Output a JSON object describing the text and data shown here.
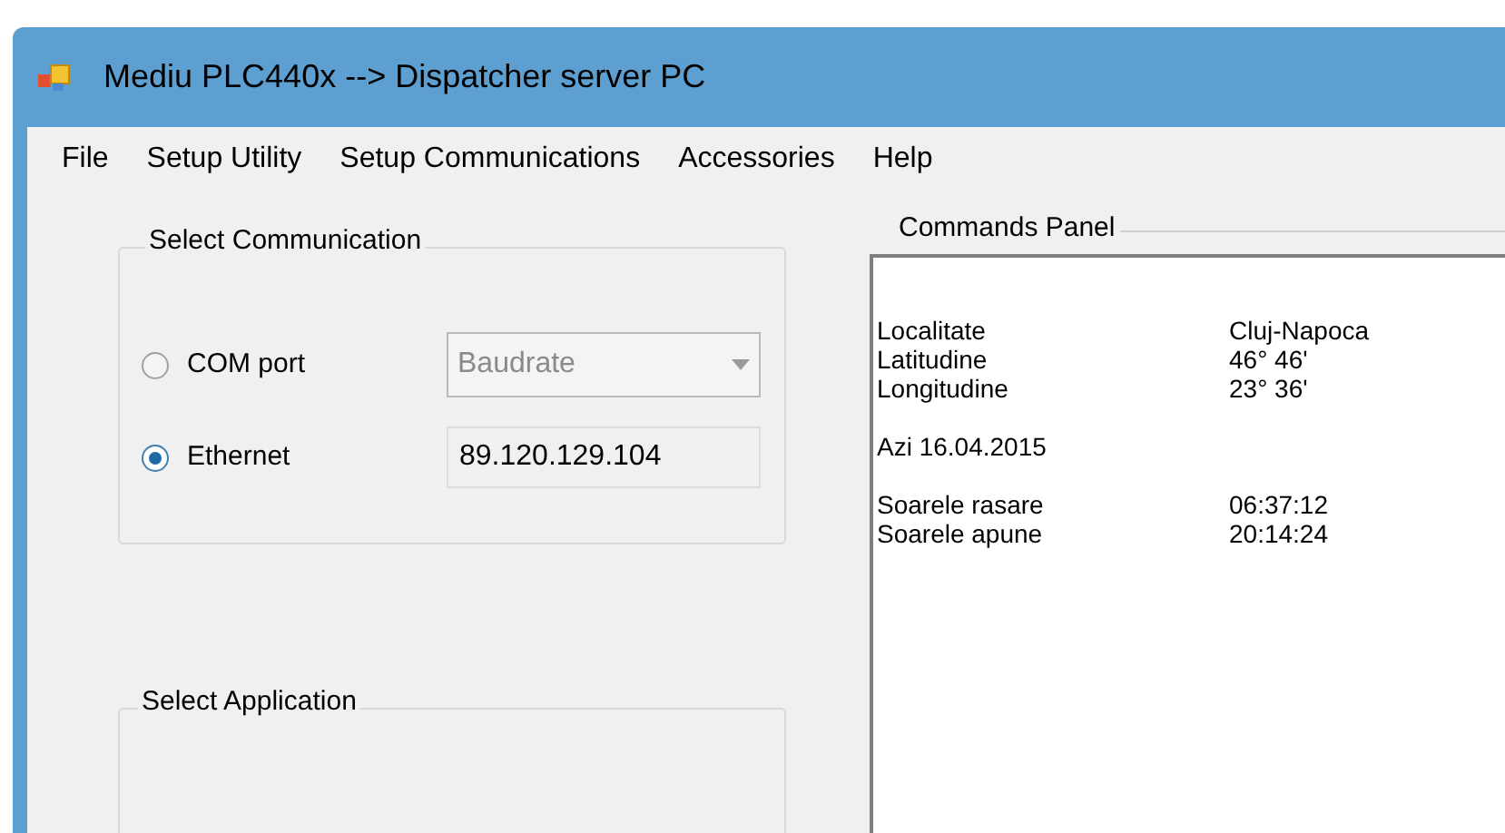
{
  "window": {
    "title": "Mediu PLC440x --> Dispatcher server PC"
  },
  "menu": [
    "File",
    "Setup Utility",
    "Setup Communications",
    "Accessories",
    "Help"
  ],
  "select_communication": {
    "title": "Select Communication",
    "options": [
      {
        "label": "COM port",
        "selected": false,
        "kind": "dropdown",
        "placeholder": "Baudrate",
        "disabled": true
      },
      {
        "label": "Ethernet",
        "selected": true,
        "kind": "field",
        "value": "89.120.129.104"
      }
    ]
  },
  "commands_panel": {
    "title": "Commands Panel",
    "groups": [
      [
        {
          "label": "Localitate",
          "value": "Cluj-Napoca"
        },
        {
          "label": "Latitudine",
          "value": "46° 46'"
        },
        {
          "label": "Longitudine",
          "value": "23° 36'"
        }
      ],
      [
        {
          "label": "Azi 16.04.2015"
        }
      ],
      [
        {
          "label": "Soarele rasare",
          "value": "06:37:12"
        },
        {
          "label": "Soarele apune",
          "value": "20:14:24"
        }
      ]
    ]
  },
  "select_application": {
    "title": "Select Application"
  }
}
